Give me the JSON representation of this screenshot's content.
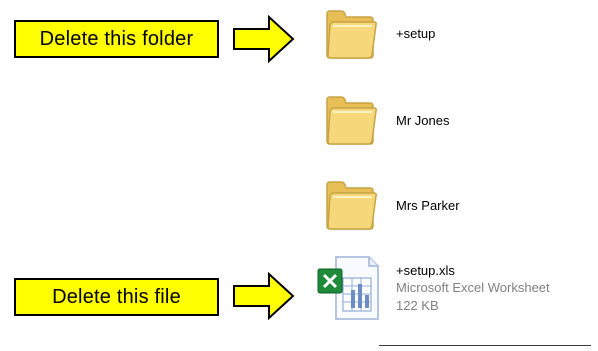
{
  "callouts": {
    "folder": "Delete this folder",
    "file": "Delete this file"
  },
  "items": [
    {
      "name": "+setup",
      "type": "folder",
      "icon": "folder-icon"
    },
    {
      "name": "Mr Jones",
      "type": "folder",
      "icon": "folder-icon"
    },
    {
      "name": "Mrs Parker",
      "type": "folder",
      "icon": "folder-icon"
    }
  ],
  "file": {
    "name": "+setup.xls",
    "type": "Microsoft Excel Worksheet",
    "size": "122 KB",
    "icon": "excel-file-icon"
  },
  "colors": {
    "callout_fill": "#ffff00",
    "folder_fill": "#f6d87a",
    "folder_outline": "#c7a445",
    "excel_green": "#1f8b3a"
  }
}
